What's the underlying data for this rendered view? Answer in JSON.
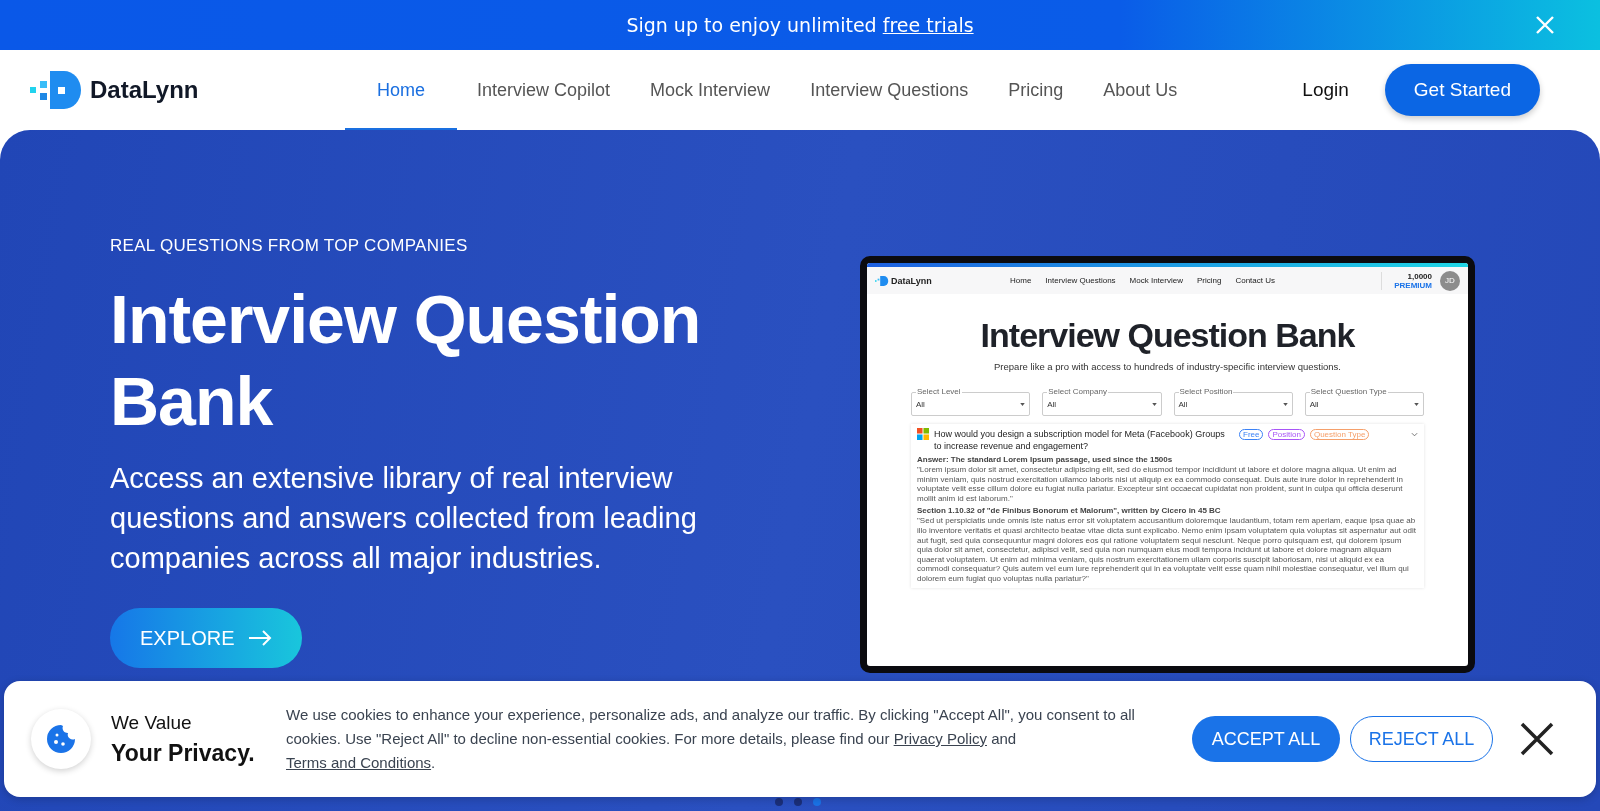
{
  "banner": {
    "text": "Sign up to enjoy unlimited ",
    "link": "free trials"
  },
  "nav": {
    "logo": "DataLynn",
    "items": [
      {
        "label": "Home",
        "selected": true
      },
      {
        "label": "Interview Copilot",
        "selected": false
      },
      {
        "label": "Mock Interview",
        "selected": false
      },
      {
        "label": "Interview Questions",
        "selected": false
      },
      {
        "label": "Pricing",
        "selected": false
      },
      {
        "label": "About Us",
        "selected": false
      }
    ],
    "login": "Login",
    "cta": "Get Started"
  },
  "hero": {
    "eyebrow": "REAL QUESTIONS FROM TOP COMPANIES",
    "title": "Interview Question Bank",
    "description": "Access an extensive library of real interview questions and answers collected from leading companies across all major industries.",
    "button": "EXPLORE"
  },
  "preview": {
    "logo": "DataLynn",
    "nav": [
      "Home",
      "Interview Questions",
      "Mock Interview",
      "Pricing",
      "Contact Us"
    ],
    "credits": "1,0000",
    "plan": "PREMIUM",
    "avatar": "JD",
    "title": "Interview Question Bank",
    "subtitle": "Prepare like a pro with access to hundreds of industry-specific interview questions.",
    "filters": [
      {
        "label": "Select Level",
        "value": "All"
      },
      {
        "label": "Select Company",
        "value": "All"
      },
      {
        "label": "Select Position",
        "value": "All"
      },
      {
        "label": "Select Question Type",
        "value": "All"
      }
    ],
    "question": {
      "text": "How would you design a subscription model for Meta (Facebook) Groups to increase revenue and engagement?",
      "tags": [
        {
          "label": "Free",
          "color": "#3b82f6"
        },
        {
          "label": "Position",
          "color": "#a855f7"
        },
        {
          "label": "Question Type",
          "color": "#f5a06b"
        }
      ],
      "sections": [
        {
          "heading": "Answer: The standard Lorem Ipsum passage, used since the 1500s",
          "body": "\"Lorem ipsum dolor sit amet, consectetur adipiscing elit, sed do eiusmod tempor incididunt ut labore et dolore magna aliqua. Ut enim ad minim veniam, quis nostrud exercitation ullamco laboris nisi ut aliquip ex ea commodo consequat. Duis aute irure dolor in reprehenderit in voluptate velit esse cillum dolore eu fugiat nulla pariatur. Excepteur sint occaecat cupidatat non proident, sunt in culpa qui officia deserunt mollit anim id est laborum.\""
        },
        {
          "heading": "Section 1.10.32 of \"de Finibus Bonorum et Malorum\", written by Cicero in 45 BC",
          "body": "\"Sed ut perspiciatis unde omnis iste natus error sit voluptatem accusantium doloremque laudantium, totam rem aperiam, eaque ipsa quae ab illo inventore veritatis et quasi architecto beatae vitae dicta sunt explicabo. Nemo enim ipsam voluptatem quia voluptas sit aspernatur aut odit aut fugit, sed quia consequuntur magni dolores eos qui ratione voluptatem sequi nesciunt. Neque porro quisquam est, qui dolorem ipsum quia dolor sit amet, consectetur, adipisci velit, sed quia non numquam eius modi tempora incidunt ut labore et dolore magnam aliquam quaerat voluptatem. Ut enim ad minima veniam, quis nostrum exercitationem ullam corporis suscipit laboriosam, nisi ut aliquid ex ea commodi consequatur? Quis autem vel eum iure reprehenderit qui in ea voluptate velit esse quam nihil molestiae consequatur, vel illum qui dolorem eum fugiat quo voluptas nulla pariatur?\""
        }
      ]
    }
  },
  "carousel": [
    {
      "selected": false
    },
    {
      "selected": false
    },
    {
      "selected": true
    }
  ],
  "cookie": {
    "title_top": "We Value",
    "title_bottom": "Your Privacy.",
    "parts": [
      {
        "text": "We use cookies to enhance your experience, personalize ads, and analyze our traffic. By clicking \"Accept All\", you consent to all cookies. Use \"Reject All\" to decline non-essential cookies. For more details, please find our ",
        "link": false
      },
      {
        "text": "Privacy Policy",
        "link": true
      },
      {
        "text": " and ",
        "link": false
      },
      {
        "text": "Terms and Conditions",
        "link": true
      },
      {
        "text": ".",
        "link": false
      }
    ],
    "accept": "ACCEPT ALL",
    "reject": "REJECT ALL"
  }
}
